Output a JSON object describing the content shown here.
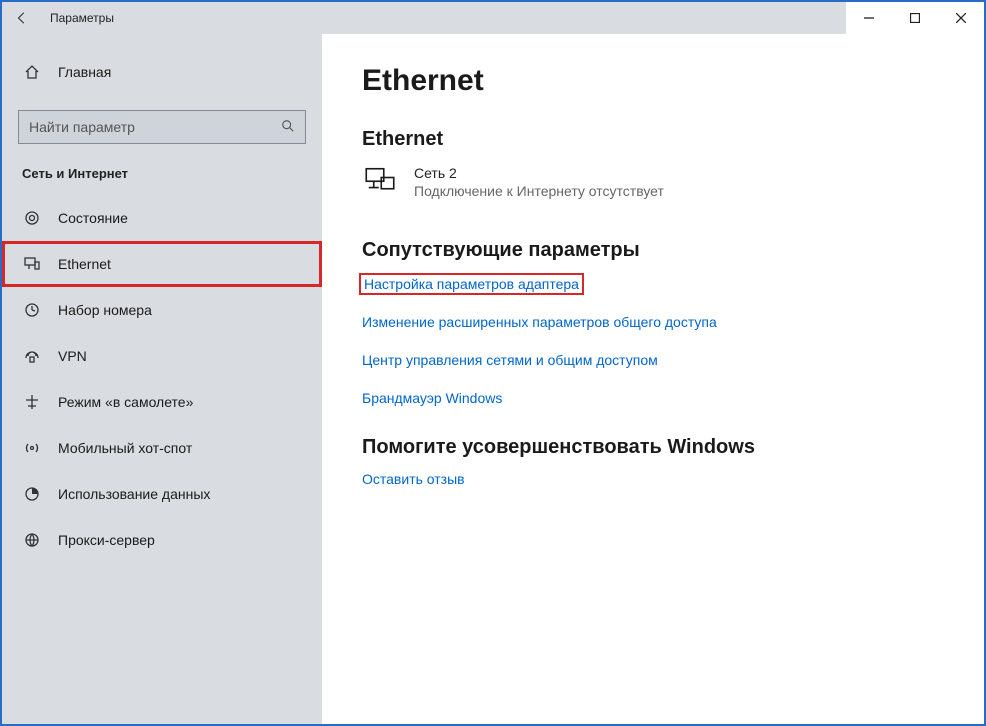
{
  "titlebar": {
    "title": "Параметры"
  },
  "home": {
    "label": "Главная"
  },
  "search": {
    "placeholder": "Найти параметр"
  },
  "section": {
    "title": "Сеть и Интернет"
  },
  "nav": {
    "items": [
      {
        "label": "Состояние"
      },
      {
        "label": "Ethernet"
      },
      {
        "label": "Набор номера"
      },
      {
        "label": "VPN"
      },
      {
        "label": "Режим «в самолете»"
      },
      {
        "label": "Мобильный хот-спот"
      },
      {
        "label": "Использование данных"
      },
      {
        "label": "Прокси-сервер"
      }
    ]
  },
  "main": {
    "heading": "Ethernet",
    "subheading": "Ethernet",
    "network": {
      "name": "Сеть  2",
      "status": "Подключение к Интернету отсутствует"
    },
    "related": {
      "title": "Сопутствующие параметры",
      "links": [
        "Настройка параметров адаптера",
        "Изменение расширенных параметров общего доступа",
        "Центр управления сетями и общим доступом",
        "Брандмауэр Windows"
      ]
    },
    "feedback": {
      "title": "Помогите усовершенствовать Windows",
      "link": "Оставить отзыв"
    }
  }
}
